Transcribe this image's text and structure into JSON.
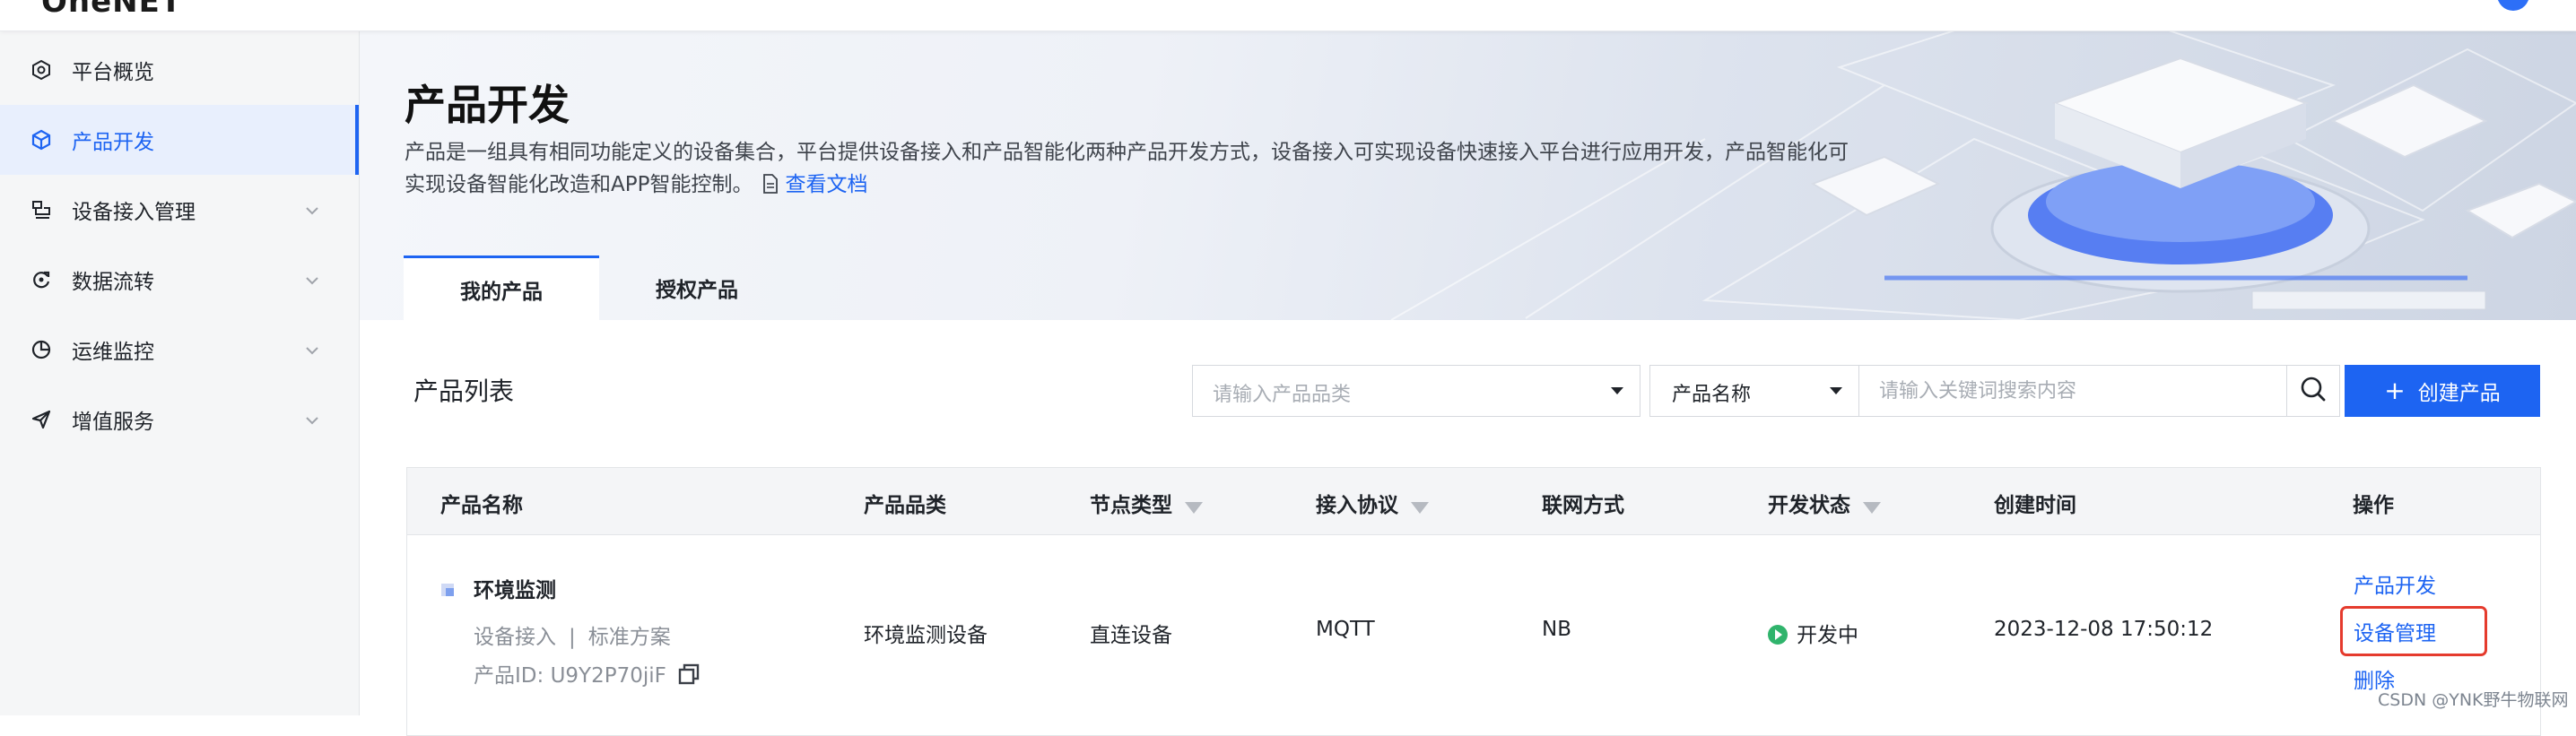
{
  "app": {
    "logo": "OneNET"
  },
  "sidebar": {
    "items": [
      {
        "label": "平台概览",
        "icon": "overview-icon",
        "active": false,
        "expandable": false
      },
      {
        "label": "产品开发",
        "icon": "cube-icon",
        "active": true,
        "expandable": false
      },
      {
        "label": "设备接入管理",
        "icon": "device-access-icon",
        "active": false,
        "expandable": true
      },
      {
        "label": "数据流转",
        "icon": "data-flow-icon",
        "active": false,
        "expandable": true
      },
      {
        "label": "运维监控",
        "icon": "monitor-icon",
        "active": false,
        "expandable": true
      },
      {
        "label": "增值服务",
        "icon": "send-icon",
        "active": false,
        "expandable": true
      }
    ]
  },
  "header": {
    "title": "产品开发",
    "description": "产品是一组具有相同功能定义的设备集合，平台提供设备接入和产品智能化两种产品开发方式，设备接入可实现设备快速接入平台进行应用开发，产品智能化可实现设备智能化改造和APP智能控制。",
    "doc_link": "查看文档"
  },
  "tabs": [
    {
      "label": "我的产品",
      "active": true
    },
    {
      "label": "授权产品",
      "active": false
    }
  ],
  "toolbar": {
    "list_title": "产品列表",
    "category_placeholder": "请输入产品品类",
    "field_select": "产品名称",
    "search_placeholder": "请输入关键词搜索内容",
    "create_label": "创建产品"
  },
  "table": {
    "columns": [
      "产品名称",
      "产品品类",
      "节点类型",
      "接入协议",
      "联网方式",
      "开发状态",
      "创建时间",
      "操作"
    ],
    "rows": [
      {
        "name": "环境监测",
        "access": "设备接入",
        "separator": "|",
        "scheme": "标准方案",
        "id_label": "产品ID:",
        "id": "U9Y2P70jiF",
        "category": "环境监测设备",
        "node_type": "直连设备",
        "protocol": "MQTT",
        "network": "NB",
        "status": "开发中",
        "created": "2023-12-08 17:50:12",
        "actions": [
          "产品开发",
          "设备管理",
          "删除"
        ]
      }
    ]
  },
  "watermark": "CSDN @YNK野牛物联网",
  "colors": {
    "accent": "#1d64f2",
    "status_green": "#30b46c",
    "highlight_red": "#e53b2d"
  }
}
